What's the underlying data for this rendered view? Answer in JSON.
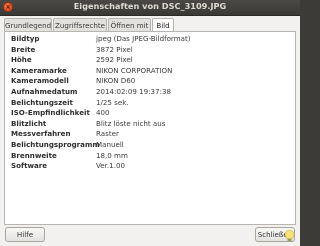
{
  "window": {
    "title": "Eigenschaften von DSC_3109.JPG"
  },
  "tabs": [
    {
      "label": "Grundlegend"
    },
    {
      "label": "Zugriffsrechte"
    },
    {
      "label": "Öffnen mit"
    },
    {
      "label": "Bild"
    }
  ],
  "properties": [
    {
      "key": "Bildtyp",
      "value": "jpeg (Das JPEG-Bildformat)"
    },
    {
      "key": "Breite",
      "value": "3872 Pixel"
    },
    {
      "key": "Höhe",
      "value": "2592 Pixel"
    },
    {
      "key": "Kameramarke",
      "value": "NIKON CORPORATION"
    },
    {
      "key": "Kameramodell",
      "value": "NIKON D60"
    },
    {
      "key": "Aufnahmedatum",
      "value": "2014:02:09 19:37:38"
    },
    {
      "key": "Belichtungszeit",
      "value": "1/25 sek."
    },
    {
      "key": "ISO-Empfindlichkeit",
      "value": "400"
    },
    {
      "key": "Blitzlicht",
      "value": "Blitz löste nicht aus"
    },
    {
      "key": "Messverfahren",
      "value": "Raster"
    },
    {
      "key": "Belichtungsprogramm",
      "value": "Manuell"
    },
    {
      "key": "Brennweite",
      "value": "18,0 mm"
    },
    {
      "key": "Software",
      "value": "Ver.1.00"
    }
  ],
  "buttons": {
    "help": "Hilfe",
    "close": "Schließen"
  },
  "colors": {
    "titlebar": "#3c3b37",
    "close_button": "#df4a16",
    "window_bg": "#f2f1f0"
  }
}
